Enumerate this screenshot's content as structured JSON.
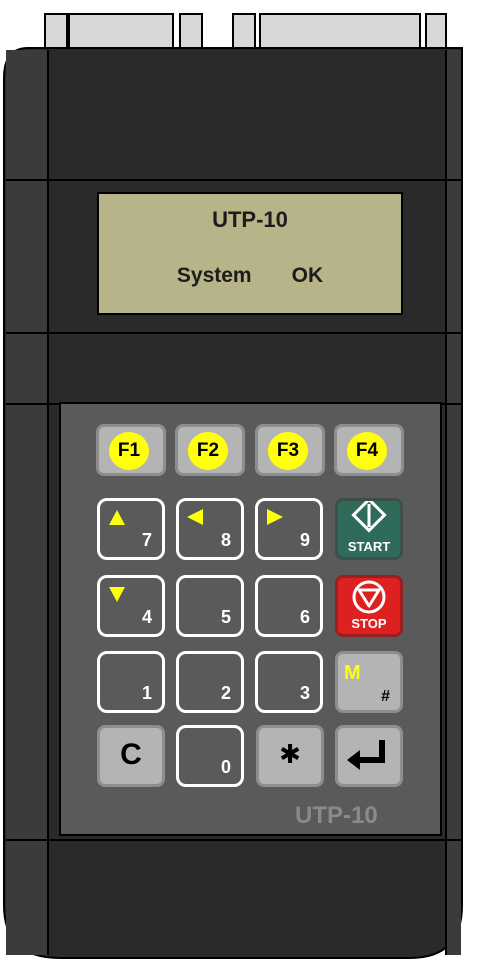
{
  "display": {
    "line1": "UTP-10",
    "line2_left": "System",
    "line2_right": "OK"
  },
  "function_keys": [
    "F1",
    "F2",
    "F3",
    "F4"
  ],
  "numeric_keys": [
    "7",
    "8",
    "9",
    "4",
    "5",
    "6",
    "1",
    "2",
    "3",
    "0"
  ],
  "keys": {
    "start": "START",
    "stop": "STOP",
    "mode_letter": "M",
    "mode_hash": "#",
    "clear": "C",
    "star": "✱",
    "enter": "↵"
  },
  "brand": "UTP-10",
  "colors": {
    "body": "#2a2a2a",
    "body_side": "#3a3a3a",
    "lcd": "#b7b48a",
    "keypad_panel": "#5a5a5a",
    "fkey_dot": "#ffff0c",
    "start_green": "#2f6b5a",
    "stop_red": "#dd2121",
    "arrow_yellow": "#ffff0c",
    "brand_gray": "#8a8a8a"
  }
}
